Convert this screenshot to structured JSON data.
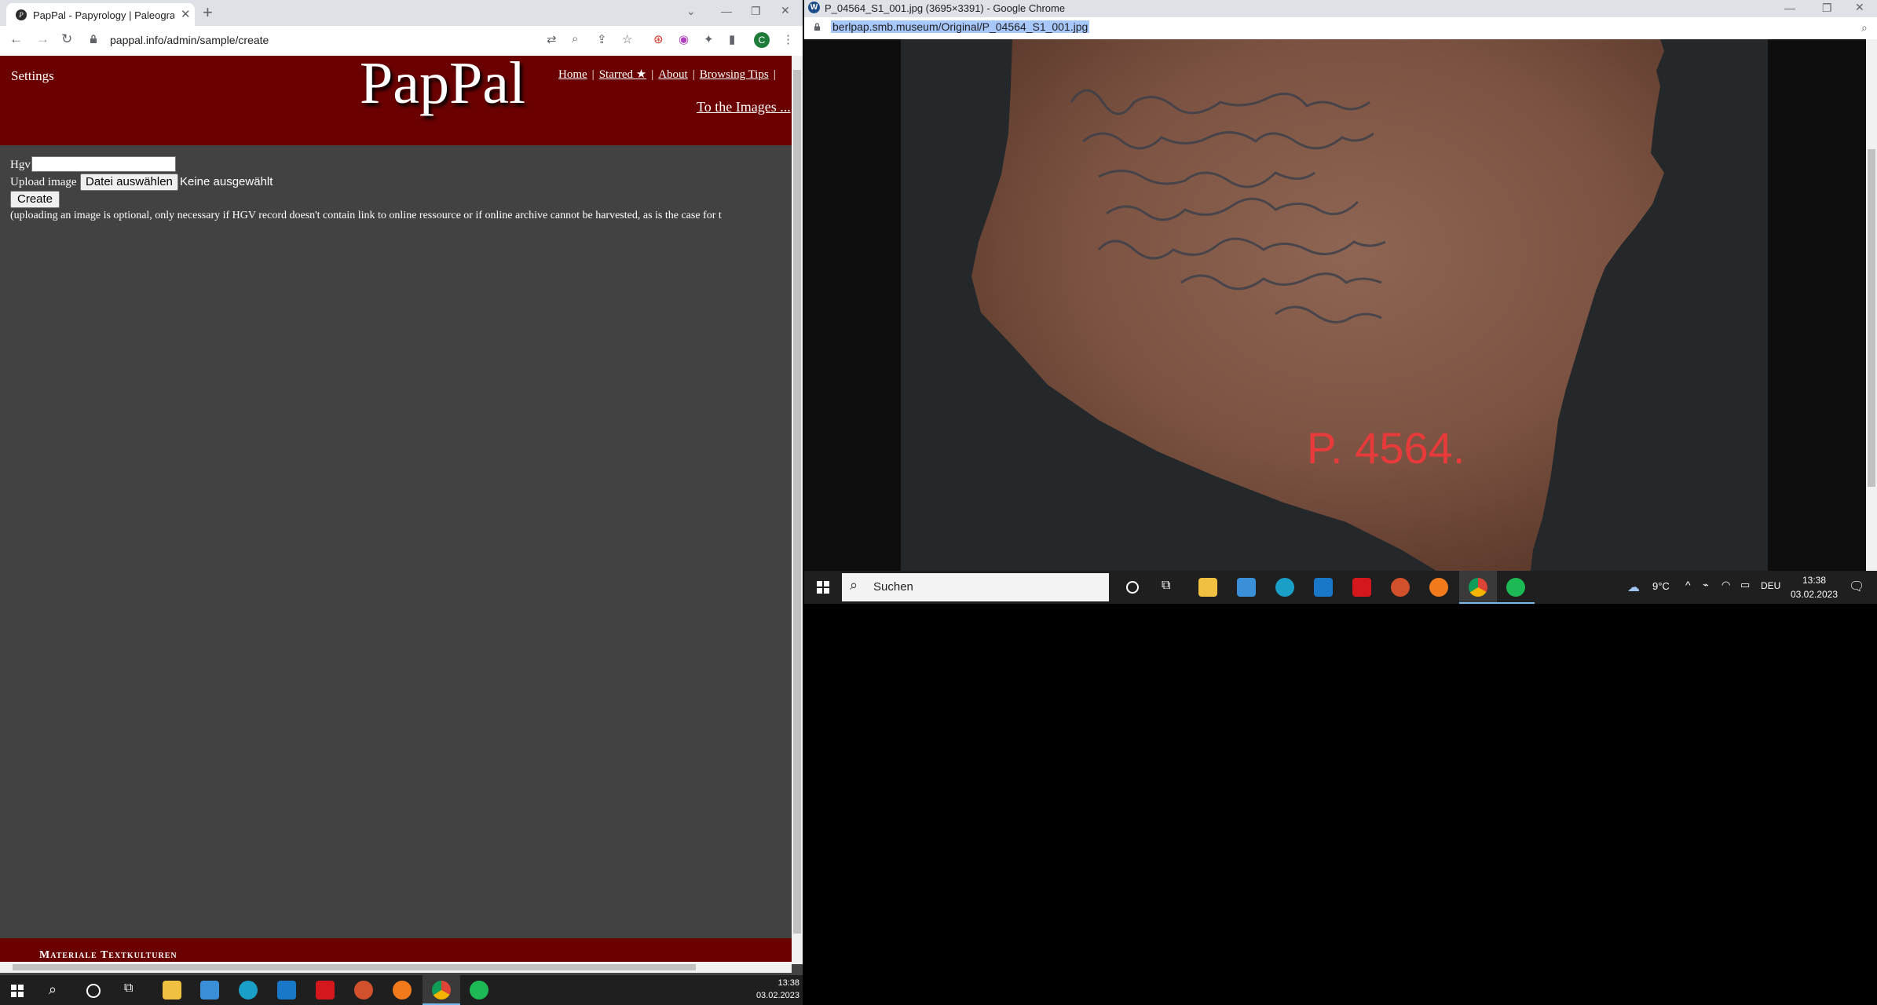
{
  "left_window": {
    "tab_title": "PapPal - Papyrology | Paleograph",
    "url": "pappal.info/admin/sample/create",
    "profile_initial": "C",
    "header": {
      "settings": "Settings",
      "logo": "PapPal",
      "nav": [
        "Home",
        "Starred ★",
        "About",
        "Browsing Tips"
      ],
      "to_images": "To the Images ..."
    },
    "form": {
      "hgv_label": "Hgv",
      "hgv_value": "",
      "upload_label": "Upload image",
      "file_button": "Datei auswählen",
      "file_status": "Keine ausgewählt",
      "create_button": "Create",
      "note": "(uploading an image is optional, only necessary if HGV record doesn't contain link to online ressource or if online archive cannot be harvested, as is the case for t"
    },
    "footer_text": "Materiale Textkulturen"
  },
  "left_taskbar": {
    "time": "13:38",
    "date": "03.02.2023"
  },
  "right_window": {
    "title": "P_04564_S1_001.jpg (3695×3391) - Google Chrome",
    "url": "berlpap.smb.museum/Original/P_04564_S1_001.jpg",
    "image_label": "P. 4564."
  },
  "right_taskbar": {
    "search_text": "Suchen",
    "temperature": "9°C",
    "language": "DEU",
    "time": "13:38",
    "date": "03.02.2023"
  },
  "colors": {
    "pappal_red": "#6b0000",
    "page_bg": "#424242",
    "url_highlight": "#a8c7fa"
  }
}
